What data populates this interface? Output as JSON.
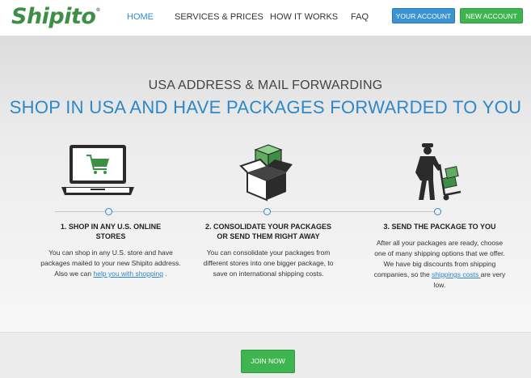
{
  "header": {
    "logo": "Shipito",
    "logo_mark": "®",
    "nav": [
      "HOME",
      "SERVICES & PRICES",
      "HOW IT WORKS",
      "FAQ"
    ],
    "your_account": "YOUR ACCOUNT",
    "new_account": "NEW ACCOUNT"
  },
  "hero": {
    "subtitle": "USA ADDRESS & MAIL FORWARDING",
    "title": "SHOP IN USA AND HAVE PACKAGES FORWARDED TO YOU"
  },
  "features": [
    {
      "icon": "laptop-cart-icon",
      "title_line1": "1. SHOP IN ANY U.S. ONLINE",
      "title_line2": "STORES",
      "text_before": "You can shop in any U.S. store and have packages mailed to your new Shipito address. Also we can ",
      "link": "help you with shopping",
      "text_after": " ."
    },
    {
      "icon": "box-consolidate-icon",
      "title_line1": "2. CONSOLIDATE YOUR PACKAGES",
      "title_line2": "OR SEND THEM RIGHT AWAY",
      "text": "You can consolidate your packages from different stores into one bigger package, to save on international shipping costs."
    },
    {
      "icon": "delivery-man-icon",
      "title_line1": "3. SEND THE PACKAGE TO YOU",
      "text_before": "After all your packages are ready, choose one of many shipping options that we offer. We have big discounts from shipping companies, so the ",
      "link": "shippings costs ",
      "text_after": "are very low."
    }
  ],
  "footer": {
    "join": "JOIN NOW"
  },
  "colors": {
    "brand_green": "#3c8f45",
    "accent_blue": "#2e87c8",
    "button_green": "#3fb54f",
    "button_blue": "#3a93d2"
  }
}
